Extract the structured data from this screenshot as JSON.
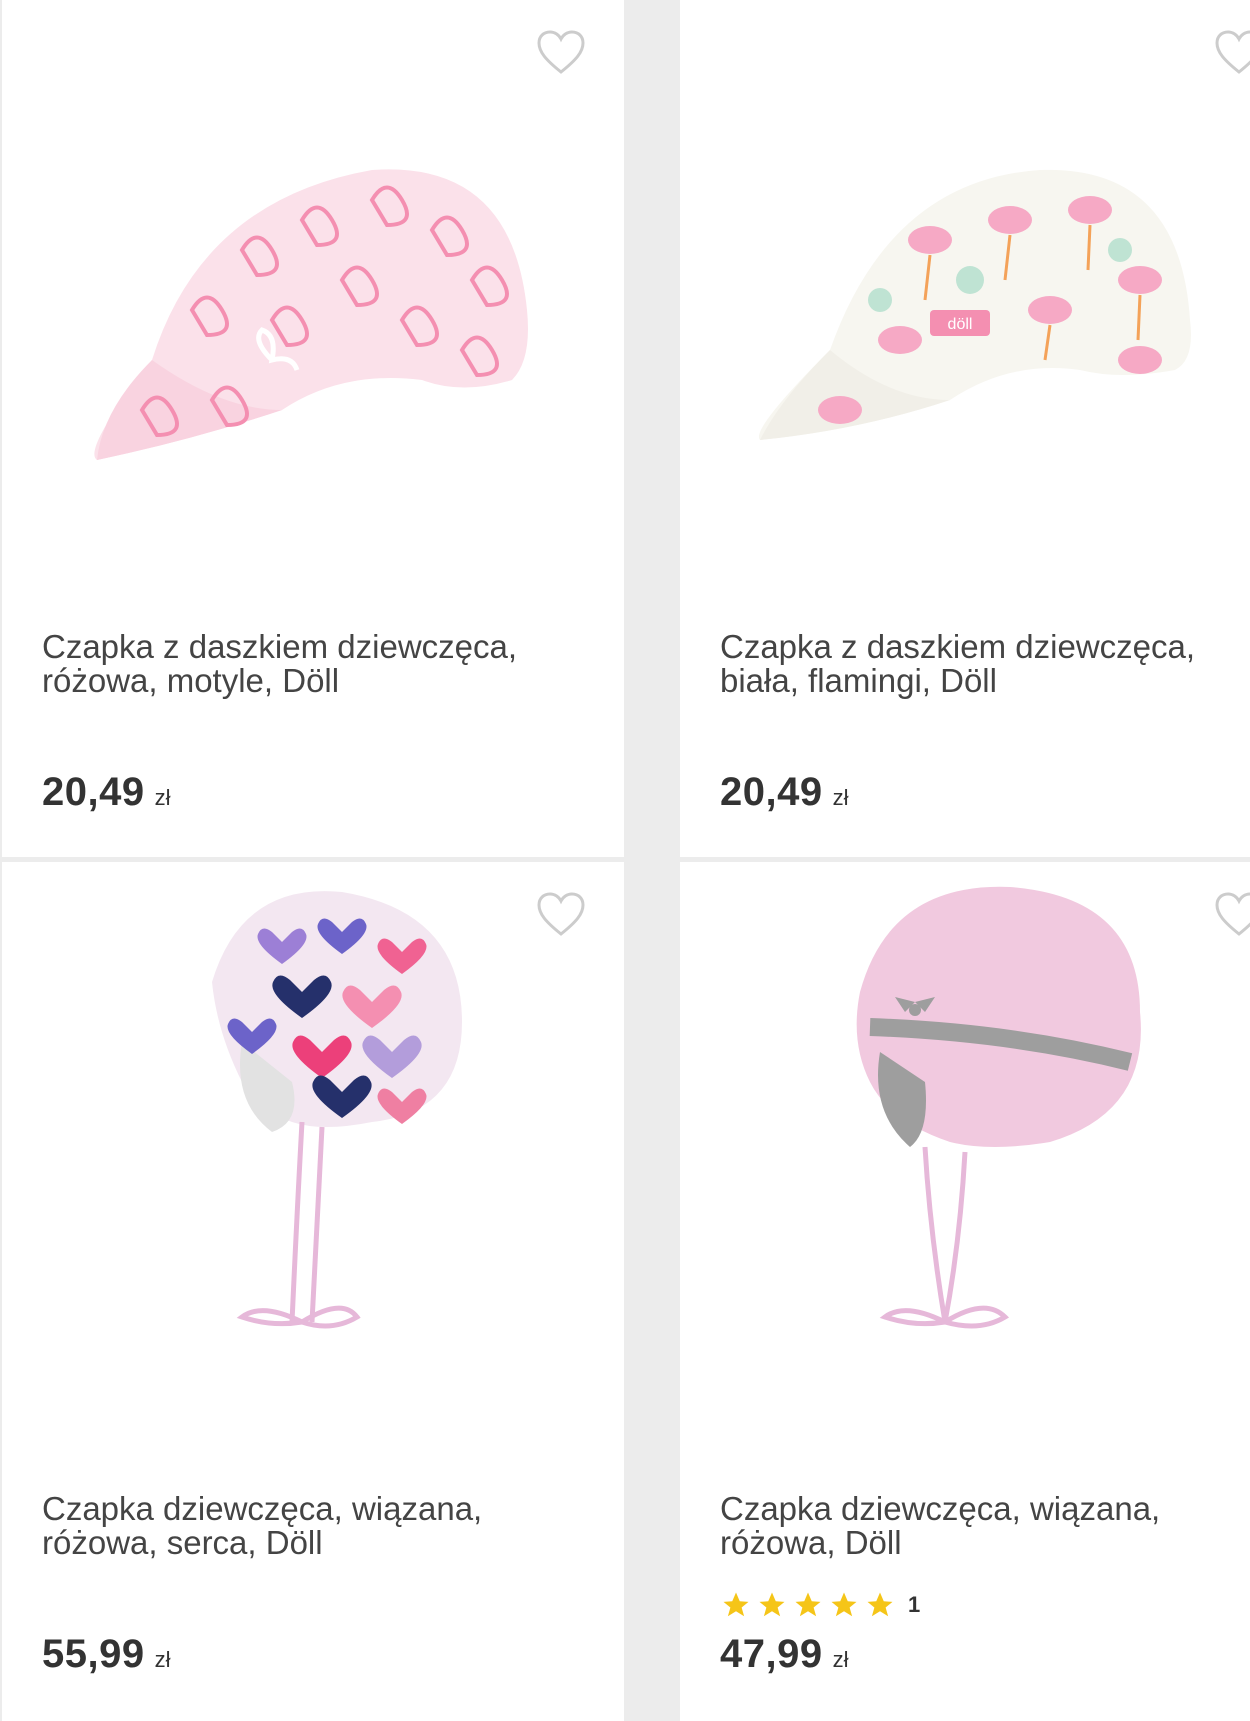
{
  "products": [
    {
      "title_line1": "Czapka z daszkiem dziewczęca,",
      "title_line2": "różowa, motyle, Döll",
      "price": "20,49",
      "currency": "zł",
      "image_icon": "butterfly-cap-icon",
      "wishlist_icon": "heart-outline-icon"
    },
    {
      "title_line1": "Czapka z daszkiem dziewczęca,",
      "title_line2": "biała, flamingi, Döll",
      "price": "20,49",
      "currency": "zł",
      "image_icon": "flamingo-cap-icon",
      "wishlist_icon": "heart-outline-icon",
      "brand_tag": "döll"
    },
    {
      "title_line1": "Czapka dziewczęca, wiązana,",
      "title_line2": "różowa, serca, Döll",
      "price": "55,99",
      "currency": "zł",
      "image_icon": "heart-beanie-icon",
      "wishlist_icon": "heart-outline-icon"
    },
    {
      "title_line1": "Czapka dziewczęca, wiązana,",
      "title_line2": "różowa, Döll",
      "price": "47,99",
      "currency": "zł",
      "rating_stars": 5,
      "rating_count": "1",
      "image_icon": "pink-beanie-icon",
      "wishlist_icon": "heart-outline-icon"
    }
  ],
  "colors": {
    "background": "#ececec",
    "card": "#ffffff",
    "text": "#444444",
    "star": "#f5c518",
    "heart_outline": "#cccccc"
  }
}
